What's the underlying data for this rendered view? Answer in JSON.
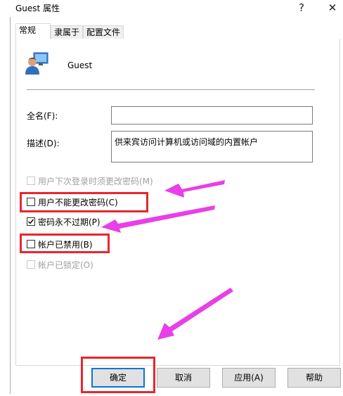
{
  "window": {
    "title": "Guest 属性",
    "help_glyph": "?",
    "close_glyph": "✕"
  },
  "tabs": [
    {
      "label": "常规"
    },
    {
      "label": "隶属于"
    },
    {
      "label": "配置文件"
    }
  ],
  "general": {
    "username": "Guest",
    "fullname_label": "全名(F):",
    "fullname_value": "",
    "description_label": "描述(D):",
    "description_value": "供来宾访问计算机或访问域的内置帐户"
  },
  "checkboxes": [
    {
      "label": "用户下次登录时须更改密码(M)",
      "checked": false,
      "enabled": false
    },
    {
      "label": "用户不能更改密码(C)",
      "checked": false,
      "enabled": true
    },
    {
      "label": "密码永不过期(P)",
      "checked": true,
      "enabled": true
    },
    {
      "label": "帐户已禁用(B)",
      "checked": false,
      "enabled": true
    },
    {
      "label": "帐户已锁定(O)",
      "checked": false,
      "enabled": false
    }
  ],
  "buttons": {
    "ok": "确定",
    "cancel": "取消",
    "apply": "应用(A)",
    "help": "帮助"
  },
  "colors": {
    "annotation_arrow": "#e83fe8",
    "annotation_box": "#e8262e",
    "focus": "#0078d7"
  }
}
